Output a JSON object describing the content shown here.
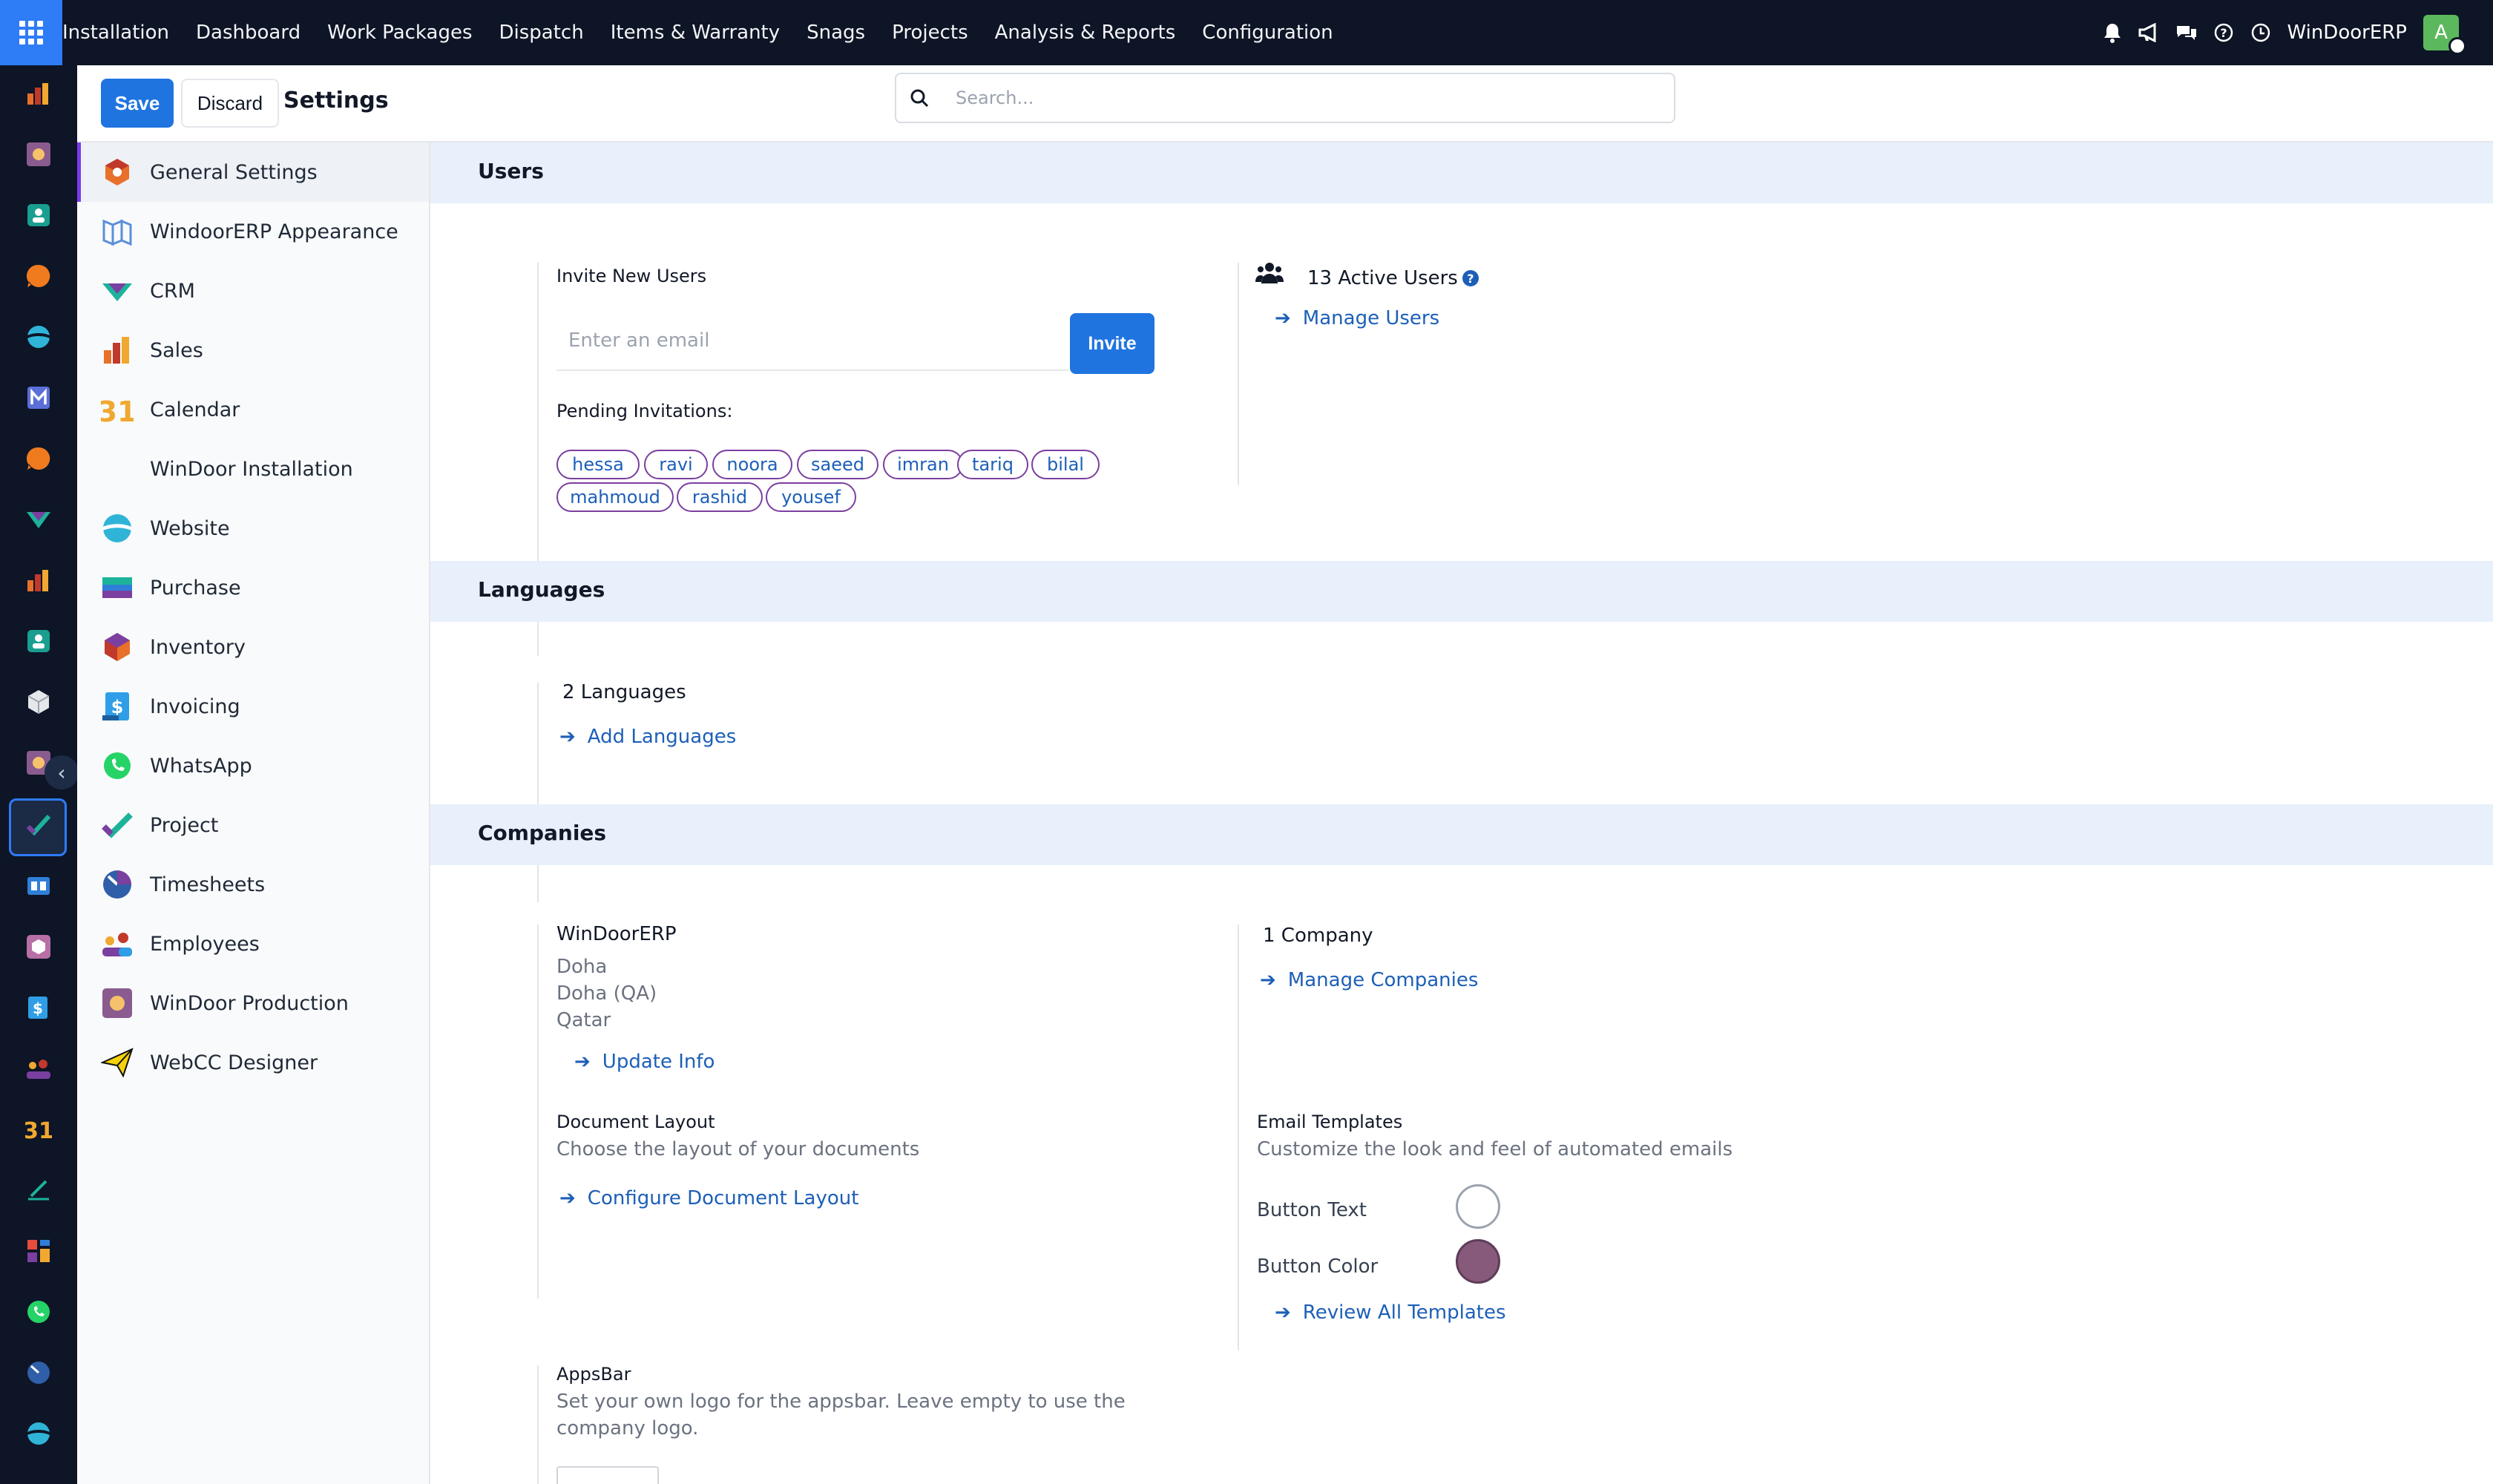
{
  "topbar": {
    "menu": [
      "Installation",
      "Dashboard",
      "Work Packages",
      "Dispatch",
      "Items & Warranty",
      "Snags",
      "Projects",
      "Analysis & Reports",
      "Configuration"
    ],
    "company": "WinDoorERP",
    "avatar_letter": "A",
    "icons": [
      "bell-icon",
      "megaphone-icon",
      "chat-icon",
      "help-icon",
      "clock-icon"
    ]
  },
  "rail": {
    "apps": [
      "Sales",
      "WinDoor Production",
      "Employees",
      "Discuss",
      "Website",
      "Email Marketing",
      "Discuss",
      "CRM",
      "Sales",
      "Contacts",
      "Inventory",
      "WinDoor Production",
      "Project",
      "Knowledge",
      "Inventory",
      "Invoicing",
      "Employees",
      "Calendar",
      "Sign",
      "Dashboards",
      "WhatsApp",
      "Timesheets",
      "Website"
    ],
    "collapse_label": "‹"
  },
  "controls": {
    "save": "Save",
    "discard": "Discard",
    "title": "Settings",
    "search_placeholder": "Search..."
  },
  "settings_nav": [
    {
      "label": "General Settings",
      "icon": "general-settings-icon",
      "active": true
    },
    {
      "label": "WindoorERP Appearance",
      "icon": "appearance-icon"
    },
    {
      "label": "CRM",
      "icon": "crm-icon"
    },
    {
      "label": "Sales",
      "icon": "sales-icon"
    },
    {
      "label": "Calendar",
      "icon": "calendar-icon"
    },
    {
      "label": "WinDoor Installation",
      "icon": ""
    },
    {
      "label": "Website",
      "icon": "website-icon"
    },
    {
      "label": "Purchase",
      "icon": "purchase-icon"
    },
    {
      "label": "Inventory",
      "icon": "inventory-icon"
    },
    {
      "label": "Invoicing",
      "icon": "invoicing-icon"
    },
    {
      "label": "WhatsApp",
      "icon": "whatsapp-icon"
    },
    {
      "label": "Project",
      "icon": "project-icon"
    },
    {
      "label": "Timesheets",
      "icon": "timesheets-icon"
    },
    {
      "label": "Employees",
      "icon": "employees-icon"
    },
    {
      "label": "WinDoor Production",
      "icon": "production-icon"
    },
    {
      "label": "WebCC Designer",
      "icon": "webcc-designer-icon"
    }
  ],
  "users": {
    "header": "Users",
    "invite_label": "Invite New Users",
    "email_placeholder": "Enter an email",
    "invite_button": "Invite",
    "pending_label": "Pending Invitations:",
    "pending": [
      "hessa",
      "ravi",
      "noora",
      "saeed",
      "imran",
      "tariq",
      "bilal",
      "mahmoud",
      "rashid",
      "yousef"
    ],
    "active_users": "13 Active Users",
    "help_glyph": "?",
    "manage_users": "Manage Users"
  },
  "languages": {
    "header": "Languages",
    "count": "2 Languages",
    "add_languages": "Add Languages"
  },
  "companies": {
    "header": "Companies",
    "name": "WinDoorERP",
    "city": "Doha",
    "state": "Doha (QA)",
    "country": "Qatar",
    "update_info": "Update Info",
    "count": "1 Company",
    "manage_companies": "Manage Companies",
    "document_layout_title": "Document Layout",
    "document_layout_desc": "Choose the layout of your documents",
    "configure_document_layout": "Configure Document Layout",
    "email_templates_title": "Email Templates",
    "email_templates_desc": "Customize the look and feel of automated emails",
    "button_text_label": "Button Text",
    "button_text_color": "#ffffff",
    "button_color_label": "Button Color",
    "button_color": "#875a7b",
    "review_all_templates": "Review All Templates",
    "appsbar_title": "AppsBar",
    "appsbar_desc_line1": "Set your own logo for the appsbar. Leave empty to use the",
    "appsbar_desc_line2": "company logo."
  },
  "colors": {
    "topbar_bg": "#0d1526",
    "primary": "#1f74e0",
    "link": "#1d5fb8",
    "section_bg": "#e8f0fc",
    "chip_border": "#7b3fa0",
    "active_nav_accent": "#7c3aed"
  }
}
